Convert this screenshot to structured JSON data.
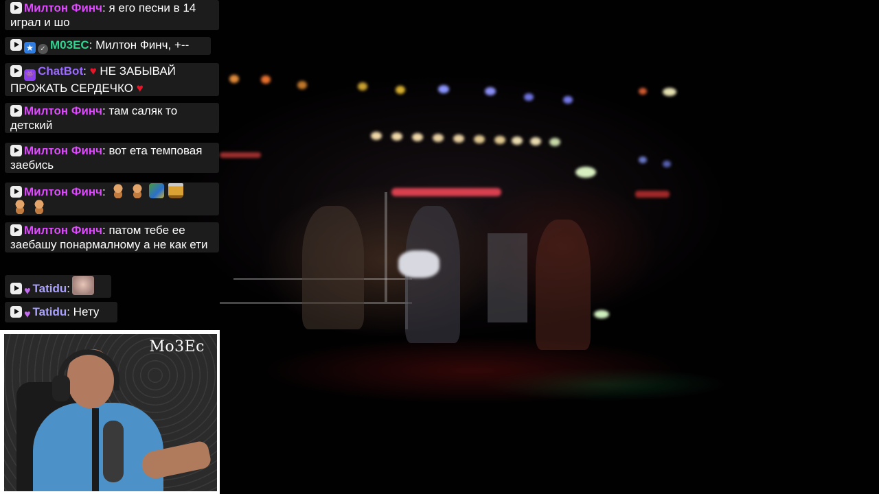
{
  "chat": {
    "messages": [
      {
        "name": "Милтон Финч",
        "text": ": я его песни в 14 играл и шо"
      },
      {
        "name": "М03ЕС",
        "text": ": Милтон Финч, +--"
      },
      {
        "name": "ChatBot",
        "sep": ":",
        "text": " НЕ ЗАБЫВАЙ ПРОЖАТЬ СЕРДЕЧКО "
      },
      {
        "name": "Милтон Финч",
        "text": ": там саляк то детский"
      },
      {
        "name": "Милтон Финч",
        "text": ": вот ета темповая заебись"
      },
      {
        "name": "Милтон Финч",
        "text": ":"
      },
      {
        "name": "Милтон Финч",
        "text": ": патом тебе ее заебашу понармалному а не как ети"
      },
      {
        "name": "Tatidu",
        "text": ":"
      },
      {
        "name": "Tatidu",
        "text": ": Нету"
      }
    ]
  },
  "webcam": {
    "label": "Mo3Ec"
  },
  "colors": {
    "pink": "#df4bff",
    "teal": "#2fd48f",
    "violet": "#9b6cff",
    "lavender": "#a9a1ff",
    "heart": "#e3162a"
  }
}
